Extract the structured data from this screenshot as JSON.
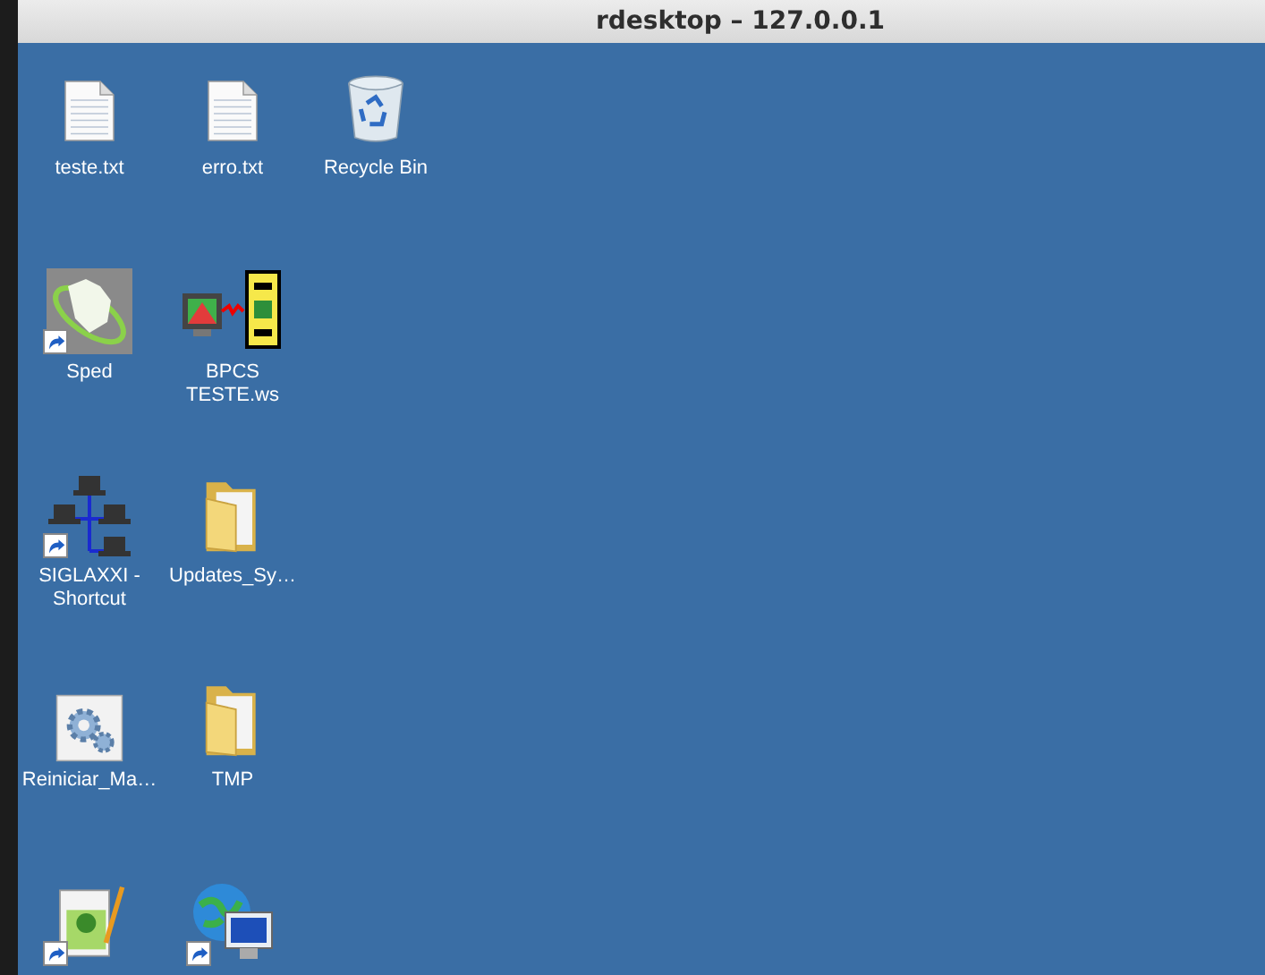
{
  "window": {
    "title": "rdesktop – 127.0.0.1"
  },
  "desktop_rows": [
    [
      {
        "label": "teste.txt",
        "kind": "textfile",
        "shortcut": false
      },
      {
        "label": "erro.txt",
        "kind": "textfile",
        "shortcut": false
      },
      {
        "label": "Recycle Bin",
        "kind": "recyclebin",
        "shortcut": false
      }
    ],
    [
      {
        "label": "Sped",
        "kind": "sped",
        "shortcut": true
      },
      {
        "label": "BPCS TESTE.ws",
        "kind": "terminal",
        "shortcut": false
      }
    ],
    [
      {
        "label": "SIGLAXXI - Shortcut",
        "kind": "network",
        "shortcut": true
      },
      {
        "label": "Updates_Sy…",
        "kind": "folder",
        "shortcut": false
      }
    ],
    [
      {
        "label": "Reiniciar_Ma…",
        "kind": "gear",
        "shortcut": false
      },
      {
        "label": "TMP",
        "kind": "folder",
        "shortcut": false
      }
    ],
    [
      {
        "kind": "notepad",
        "shortcut": true
      },
      {
        "kind": "globe",
        "shortcut": true
      }
    ]
  ]
}
